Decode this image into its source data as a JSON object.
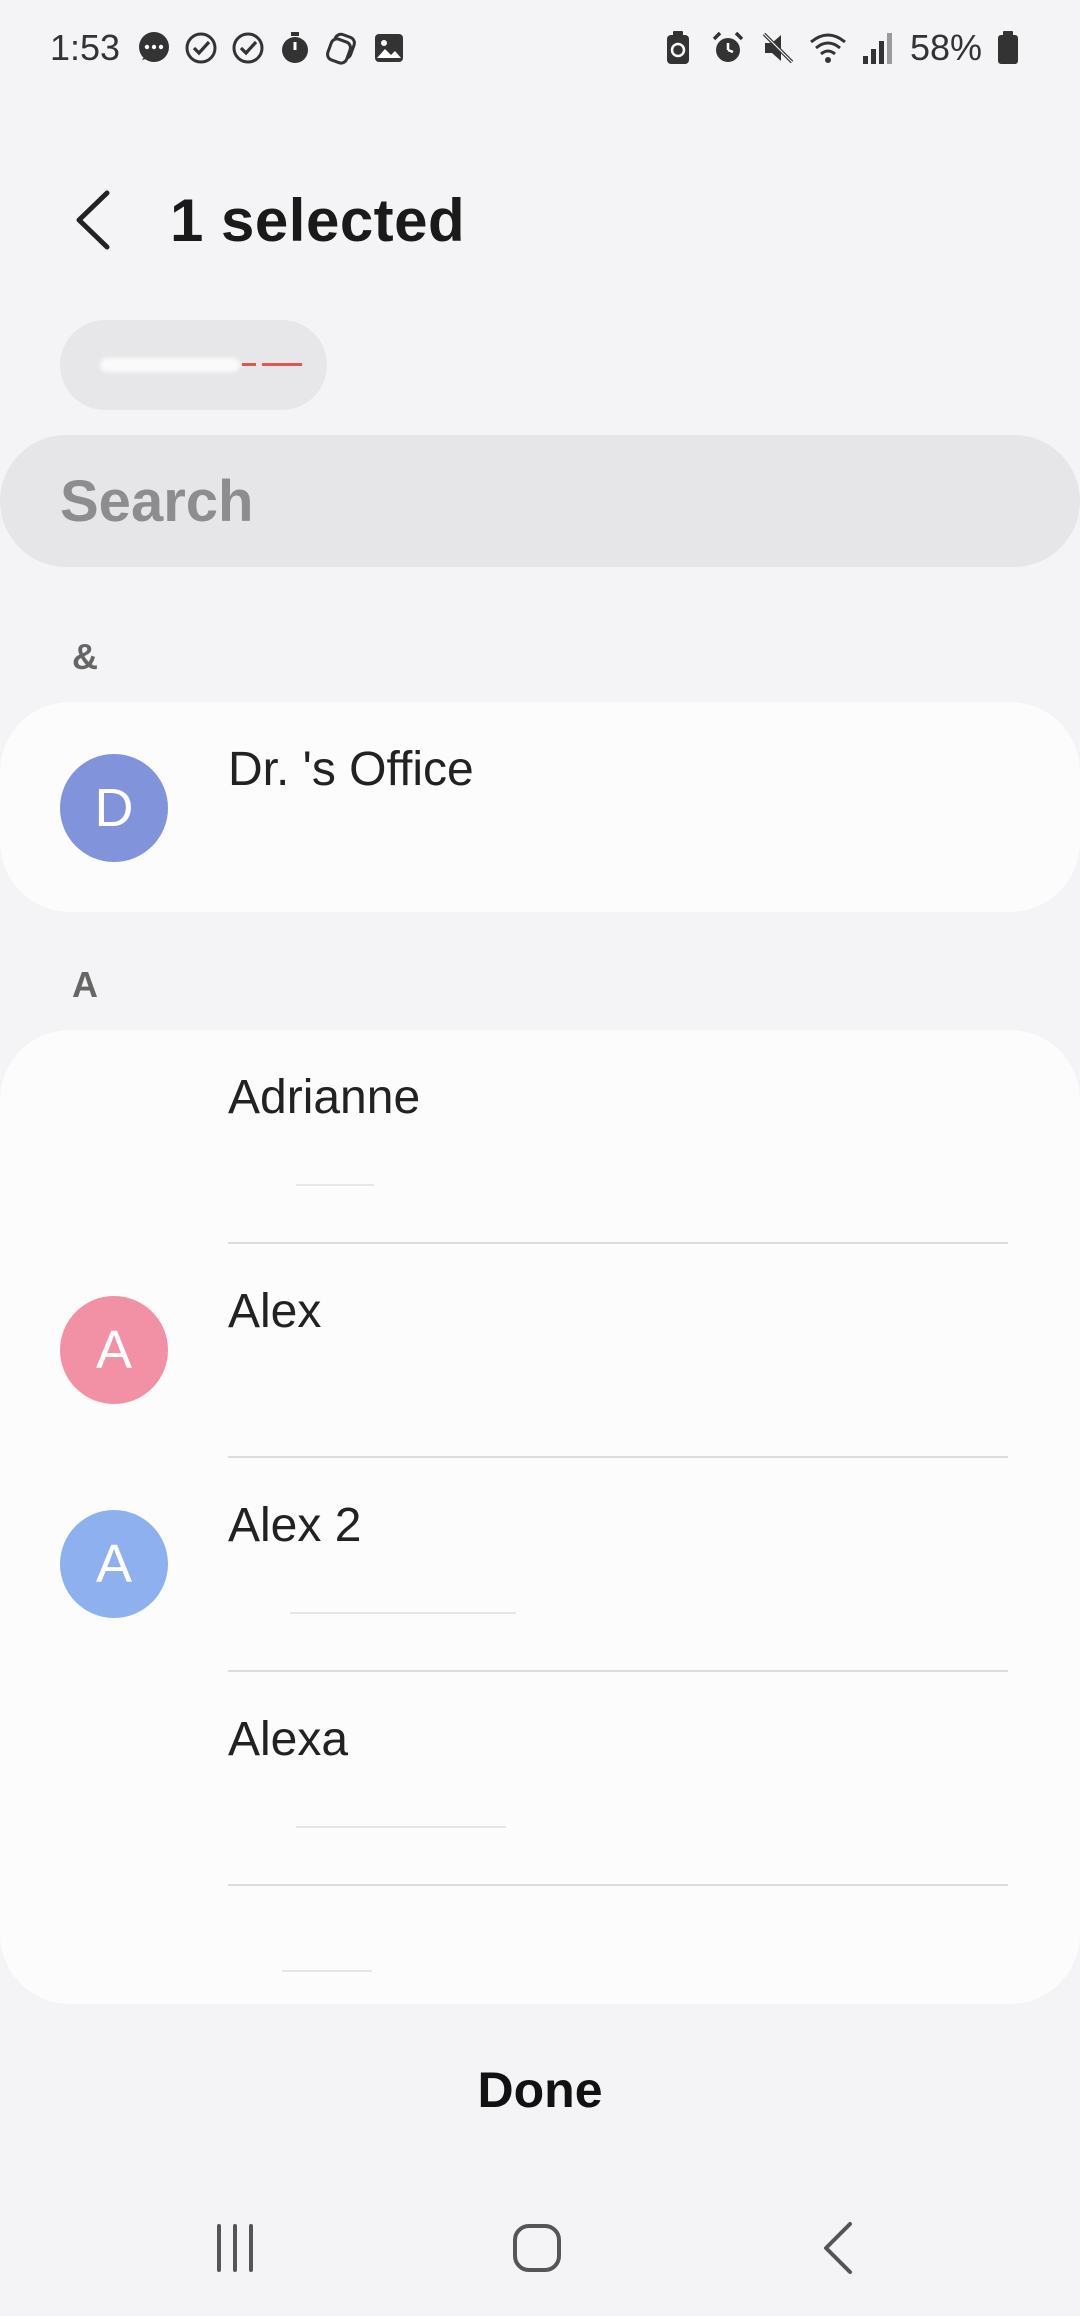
{
  "status_bar": {
    "time": "1:53",
    "battery_percent": "58%",
    "left_icons": [
      "chat-bubble-icon",
      "check-circle-icon",
      "check-circle-icon",
      "stopwatch-icon",
      "layers-icon",
      "image-icon"
    ],
    "right_icons": [
      "battery-saver-icon",
      "alarm-icon",
      "mute-icon",
      "wifi-icon",
      "signal-icon",
      "battery-icon"
    ]
  },
  "header": {
    "back_icon": "chevron-left-icon",
    "title": "1 selected"
  },
  "search": {
    "placeholder": "Search"
  },
  "sections": [
    {
      "header": "&",
      "contacts": [
        {
          "name": "Dr. 's Office",
          "initial": "D",
          "avatar_color": "#8194db"
        }
      ]
    },
    {
      "header": "A",
      "contacts": [
        {
          "name": "Adrianne",
          "initial": "",
          "avatar_color": ""
        },
        {
          "name": "Alex",
          "initial": "A",
          "avatar_color": "#f290a6"
        },
        {
          "name": "Alex 2",
          "initial": "A",
          "avatar_color": "#8fb0ee"
        },
        {
          "name": "Alexa",
          "initial": "",
          "avatar_color": ""
        }
      ]
    }
  ],
  "footer": {
    "done_label": "Done"
  },
  "nav_bar": {
    "icons": [
      "recents-icon",
      "home-icon",
      "back-icon"
    ]
  },
  "colors": {
    "background": "#f4f4f6",
    "card": "#fcfcfc",
    "search": "#e6e6e8",
    "accent_red": "#e05555"
  }
}
